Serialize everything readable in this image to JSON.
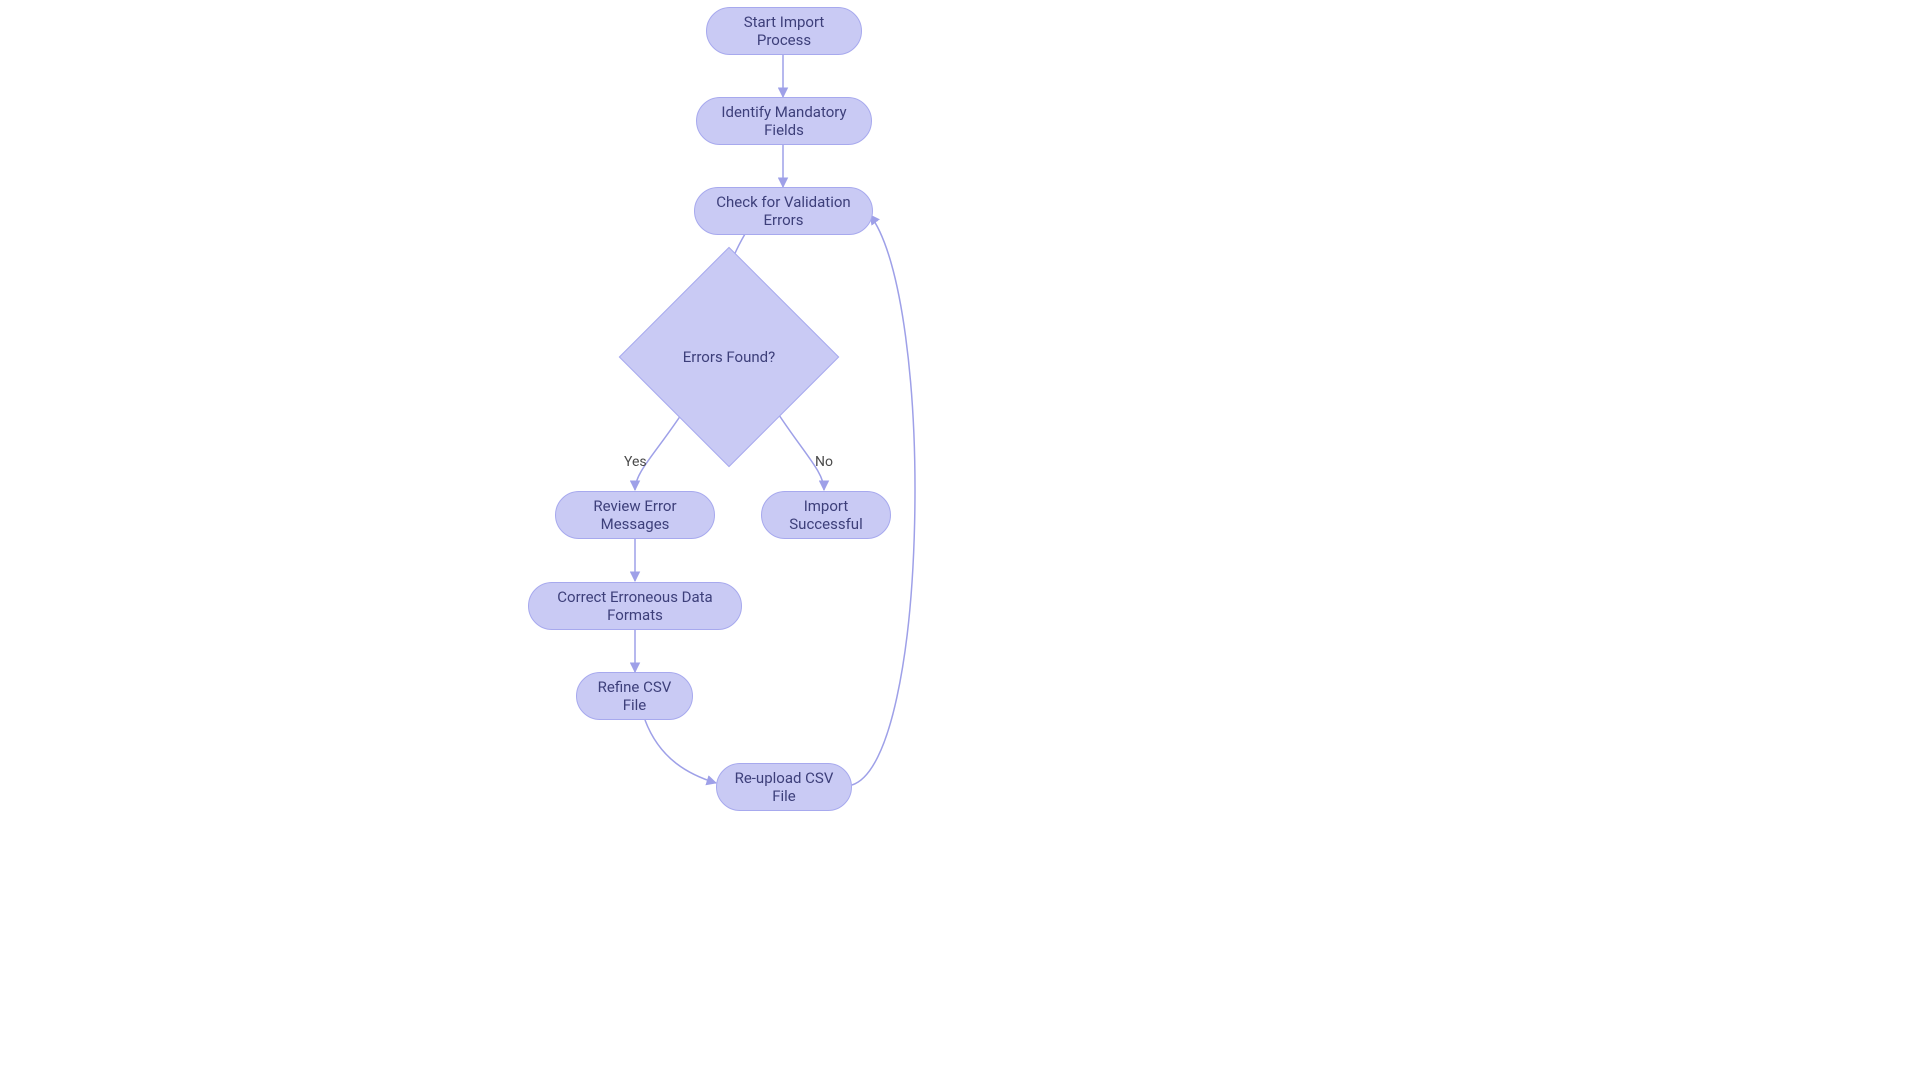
{
  "flowchart": {
    "type": "flowchart",
    "nodes": {
      "start": {
        "label": "Start Import Process",
        "shape": "pill"
      },
      "identify": {
        "label": "Identify Mandatory Fields",
        "shape": "pill"
      },
      "check": {
        "label": "Check for Validation Errors",
        "shape": "pill"
      },
      "decision": {
        "label": "Errors Found?",
        "shape": "diamond"
      },
      "review": {
        "label": "Review Error Messages",
        "shape": "pill"
      },
      "correct": {
        "label": "Correct Erroneous Data Formats",
        "shape": "pill"
      },
      "refine": {
        "label": "Refine CSV File",
        "shape": "pill"
      },
      "reupload": {
        "label": "Re-upload CSV File",
        "shape": "pill"
      },
      "success": {
        "label": "Import Successful",
        "shape": "pill"
      }
    },
    "edges": [
      {
        "from": "start",
        "to": "identify",
        "label": ""
      },
      {
        "from": "identify",
        "to": "check",
        "label": ""
      },
      {
        "from": "check",
        "to": "decision",
        "label": ""
      },
      {
        "from": "decision",
        "to": "review",
        "label": "Yes"
      },
      {
        "from": "decision",
        "to": "success",
        "label": "No"
      },
      {
        "from": "review",
        "to": "correct",
        "label": ""
      },
      {
        "from": "correct",
        "to": "refine",
        "label": ""
      },
      {
        "from": "refine",
        "to": "reupload",
        "label": ""
      },
      {
        "from": "reupload",
        "to": "check",
        "label": ""
      }
    ],
    "edge_labels": {
      "yes": "Yes",
      "no": "No"
    },
    "colors": {
      "node_fill": "#c9caf4",
      "node_stroke": "#a7a9ee",
      "text": "#3d3f7a",
      "edge": "#9ea0e8"
    }
  }
}
